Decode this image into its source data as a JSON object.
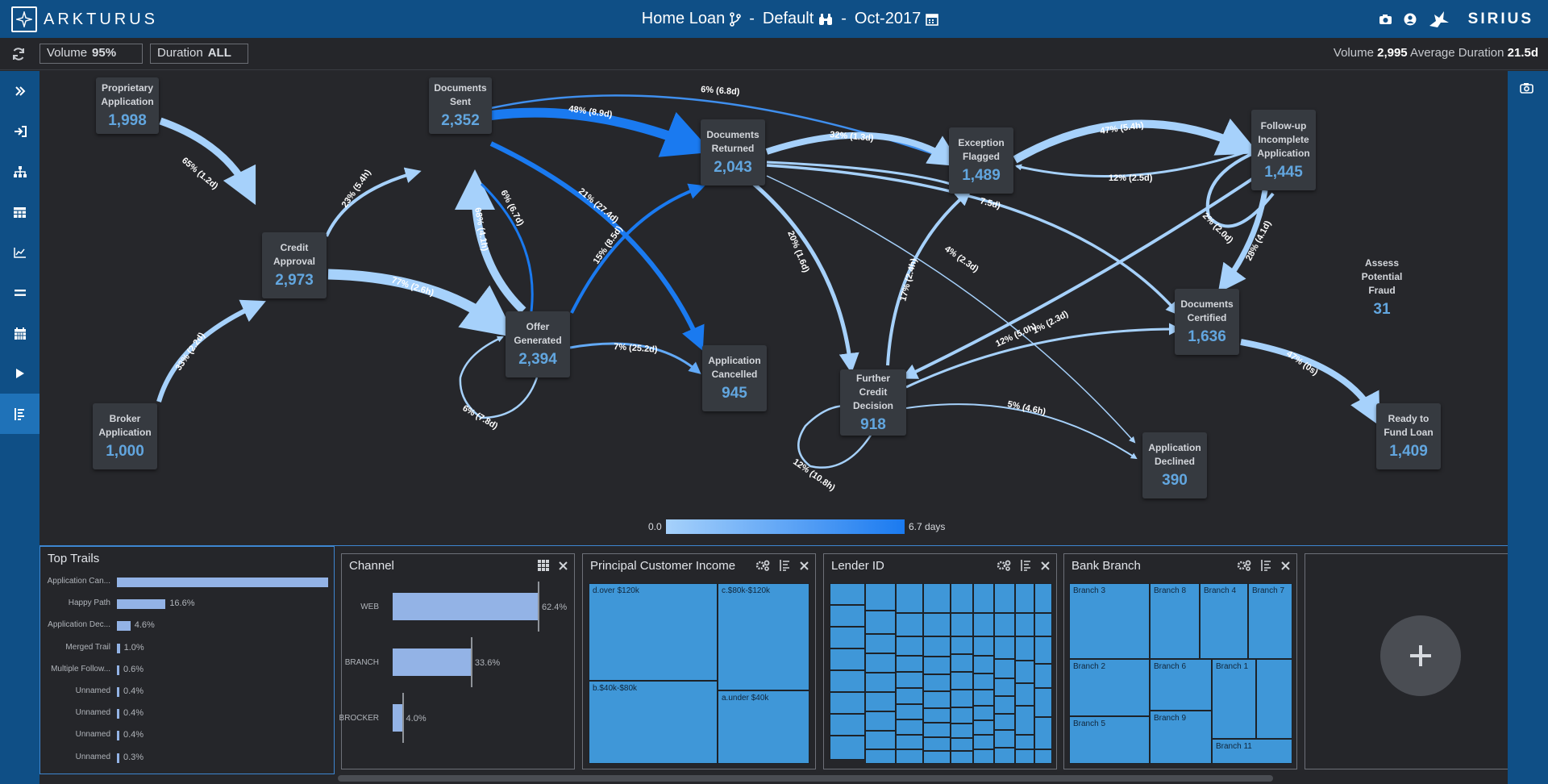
{
  "app": {
    "brand": "ARKTURUS",
    "partner": "SIRIUS"
  },
  "header": {
    "title": "Home Loan",
    "sep1": "-",
    "view": "Default",
    "sep2": "-",
    "period": "Oct-2017"
  },
  "filters": {
    "volume_label": "Volume",
    "volume_value": "95%",
    "duration_label": "Duration",
    "duration_value": "ALL"
  },
  "stats": {
    "volume_label": "Volume",
    "volume_value": "2,995",
    "duration_label": "Average Duration",
    "duration_value": "21.5d"
  },
  "sidebar": {
    "items": [
      "expand-icon",
      "login-icon",
      "hierarchy-icon",
      "table-icon",
      "line-chart-icon",
      "equals-icon",
      "calendar-icon",
      "play-icon",
      "trails-icon"
    ]
  },
  "process_map": {
    "nodes": [
      {
        "id": "prop",
        "label": "Proprietary Application",
        "value": "1,998"
      },
      {
        "id": "docsent",
        "label": "Documents Sent",
        "value": "2,352"
      },
      {
        "id": "docret",
        "label": "Documents Returned",
        "value": "2,043"
      },
      {
        "id": "exc",
        "label": "Exception Flagged",
        "value": "1,489"
      },
      {
        "id": "follow",
        "label": "Follow-up Incomplete Application",
        "value": "1,445"
      },
      {
        "id": "credit",
        "label": "Credit Approval",
        "value": "2,973"
      },
      {
        "id": "offer",
        "label": "Offer Generated",
        "value": "2,394"
      },
      {
        "id": "appcanc",
        "label": "Application Cancelled",
        "value": "945"
      },
      {
        "id": "further",
        "label": "Further Credit Decision",
        "value": "918"
      },
      {
        "id": "doccert",
        "label": "Documents Certified",
        "value": "1,636"
      },
      {
        "id": "fraud",
        "label": "Assess Potential Fraud",
        "value": "31"
      },
      {
        "id": "broker",
        "label": "Broker Application",
        "value": "1,000"
      },
      {
        "id": "appdecl",
        "label": "Application Declined",
        "value": "390"
      },
      {
        "id": "ready",
        "label": "Ready to Fund Loan",
        "value": "1,409"
      }
    ],
    "edges": [
      {
        "label": "65% (1.2d)"
      },
      {
        "label": "33% (2.2d)"
      },
      {
        "label": "23% (5.4h)"
      },
      {
        "label": "77% (2.6h)"
      },
      {
        "label": "48% (8.9d)"
      },
      {
        "label": "6% (6.8d)"
      },
      {
        "label": "6% (6.7d)"
      },
      {
        "label": "68% (4.1h)"
      },
      {
        "label": "21% (27.4d)"
      },
      {
        "label": "15% (8.5d)"
      },
      {
        "label": "7% (25.2d)"
      },
      {
        "label": "6% (7.8d)"
      },
      {
        "label": "32% (1.3d)"
      },
      {
        "label": "20% (1.6d)"
      },
      {
        "label": "4% (2.3d)"
      },
      {
        "label": "47% (5.4h)"
      },
      {
        "label": "12% (2.5d)"
      },
      {
        "label": "7.5d)"
      },
      {
        "label": "2% (2.0d)"
      },
      {
        "label": "28% (4.1d)"
      },
      {
        "label": "12% (5.0h)"
      },
      {
        "label": "1% (2.3d)"
      },
      {
        "label": "47% (0s)"
      },
      {
        "label": "5% (4.6h)"
      },
      {
        "label": "12% (10.8h)"
      },
      {
        "label": "17% (2.4h)"
      }
    ]
  },
  "legend": {
    "min": "0.0",
    "max": "6.7 days"
  },
  "top_trails": {
    "title": "Top Trails",
    "rows": [
      {
        "label": "Application Can...",
        "value": 72.1,
        "pct": ""
      },
      {
        "label": "Happy Path",
        "value": 16.6,
        "pct": "16.6%"
      },
      {
        "label": "Application Dec...",
        "value": 4.6,
        "pct": "4.6%"
      },
      {
        "label": "Merged Trail",
        "value": 1.0,
        "pct": "1.0%"
      },
      {
        "label": "Multiple Follow...",
        "value": 0.6,
        "pct": "0.6%"
      },
      {
        "label": "Unnamed",
        "value": 0.4,
        "pct": "0.4%"
      },
      {
        "label": "Unnamed",
        "value": 0.4,
        "pct": "0.4%"
      },
      {
        "label": "Unnamed",
        "value": 0.4,
        "pct": "0.4%"
      },
      {
        "label": "Unnamed",
        "value": 0.3,
        "pct": "0.3%"
      }
    ]
  },
  "channel": {
    "title": "Channel",
    "rows": [
      {
        "label": "WEB",
        "value": 62.4,
        "pct": "62.4%"
      },
      {
        "label": "BRANCH",
        "value": 33.6,
        "pct": "33.6%"
      },
      {
        "label": "BROCKER",
        "value": 4.0,
        "pct": "4.0%"
      }
    ]
  },
  "income": {
    "title": "Principal Customer Income",
    "cells": [
      "d.over $120k",
      "c.$80k-$120k",
      "b.$40k-$80k",
      "a.under $40k"
    ]
  },
  "lender": {
    "title": "Lender ID"
  },
  "branch": {
    "title": "Bank Branch",
    "cells": [
      "Branch 3",
      "Branch 8",
      "Branch 4",
      "Branch 7",
      "Branch 2",
      "Branch 6",
      "Branch 1",
      "Branch 5",
      "Branch 9",
      "Branch 11"
    ]
  },
  "colors": {
    "header": "#0f4f86",
    "node_value": "#62a6df",
    "edge_light": "#a6d1fb",
    "edge_dark": "#1a7af0",
    "bar": "#93b3e6",
    "treemap": "#3f97d8"
  }
}
